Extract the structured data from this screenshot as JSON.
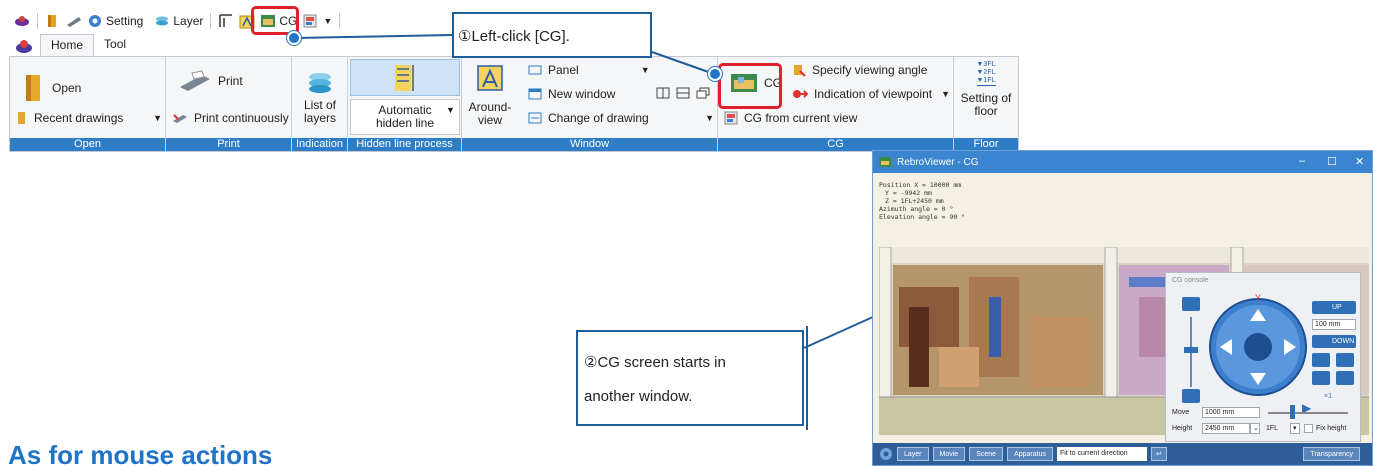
{
  "quick_access": {
    "setting_label": "Setting",
    "layer_label": "Layer",
    "cg_label": "CG"
  },
  "tabs": [
    {
      "label": "Home",
      "active": true
    },
    {
      "label": "Tool",
      "active": false
    }
  ],
  "ribbon": {
    "open": {
      "open_label": "Open",
      "recent_label": "Recent drawings",
      "group_label": "Open"
    },
    "print": {
      "print_label": "Print",
      "print_cont_label": "Print continuously",
      "group_label": "Print"
    },
    "indication": {
      "layers_label": "List of layers",
      "group_label": "Indication"
    },
    "hidden_line": {
      "auto_label": "Automatic hidden line",
      "group_label": "Hidden line process"
    },
    "window": {
      "around_label": "Around-view",
      "panel_label": "Panel",
      "new_window_label": "New window",
      "change_label": "Change of drawing",
      "group_label": "Window"
    },
    "cg": {
      "cg_label": "CG",
      "viewing_label": "Specify viewing angle",
      "viewpoint_label": "Indication of viewpoint",
      "current_view_label": "CG from current view",
      "group_label": "CG"
    },
    "floor": {
      "floor_levels": [
        "▼3FL",
        "▼2FL",
        "▼1FL"
      ],
      "setting_label": "Setting of floor",
      "group_label": "Floor"
    }
  },
  "callouts": {
    "step1": "①Left-click [CG].",
    "step2_line1": "②CG screen starts in",
    "step2_line2": "another window."
  },
  "cg_window": {
    "title": "RebroViewer - CG",
    "info": [
      "Position X = 10000 mm",
      "Y = -9942 mm",
      "Z = 1FL+2450 mm",
      "Azimuth angle = 0 °",
      "Elevation angle = 90 °"
    ],
    "console": {
      "title": "CG console",
      "up_label": "UP",
      "down_label": "DOWN",
      "step_value": "100 mm",
      "move_label": "Move",
      "move_value": "1000 mm",
      "height_label": "Height",
      "height_value": "2450 mm",
      "floor_value": "1FL",
      "fix_height_label": "Fix height",
      "speed_label": "×1"
    },
    "bottom_bar": {
      "layer": "Layer",
      "movie": "Movie",
      "scene": "Scene",
      "apparatus": "Apparatus",
      "direction": "Fit to current direction",
      "transparency": "Transparency"
    }
  },
  "colors": {
    "ribbon_group_label": "#2e7dc6",
    "highlight_red": "#e0202a",
    "callout_blue": "#1f5c99",
    "heading_blue": "#1f73c8"
  },
  "section_heading": "As for mouse actions"
}
